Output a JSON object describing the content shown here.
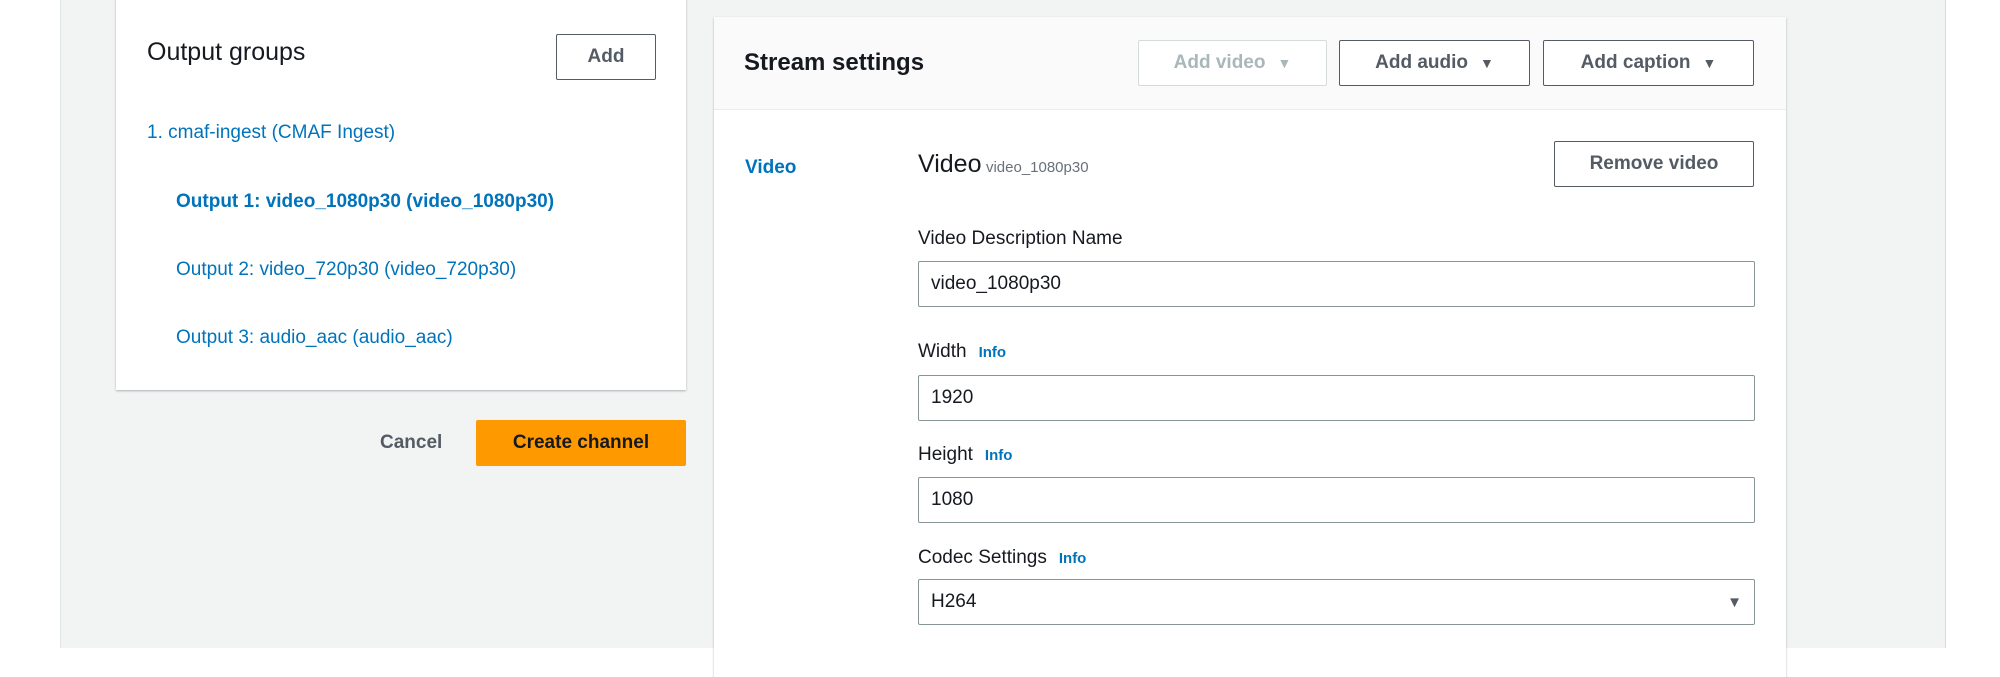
{
  "output_groups": {
    "title": "Output groups",
    "add_label": "Add",
    "group": "1. cmaf-ingest (CMAF Ingest)",
    "outputs": [
      "Output 1: video_1080p30 (video_1080p30)",
      "Output 2: video_720p30 (video_720p30)",
      "Output 3: audio_aac (audio_aac)"
    ],
    "selected_index": 0
  },
  "actions": {
    "cancel": "Cancel",
    "create": "Create channel"
  },
  "stream": {
    "title": "Stream settings",
    "add_video": "Add video",
    "add_audio": "Add audio",
    "add_caption": "Add caption",
    "nav_video": "Video",
    "section_title": "Video",
    "section_sub": "video_1080p30",
    "remove_video": "Remove video",
    "fields": {
      "name_label": "Video Description Name",
      "name_value": "video_1080p30",
      "width_label": "Width",
      "width_value": "1920",
      "height_label": "Height",
      "height_value": "1080",
      "codec_label": "Codec Settings",
      "codec_value": "H264",
      "info": "Info"
    }
  },
  "colors": {
    "accent": "#0073bb",
    "primary_button": "#ff9900",
    "background": "#f2f3f3"
  }
}
